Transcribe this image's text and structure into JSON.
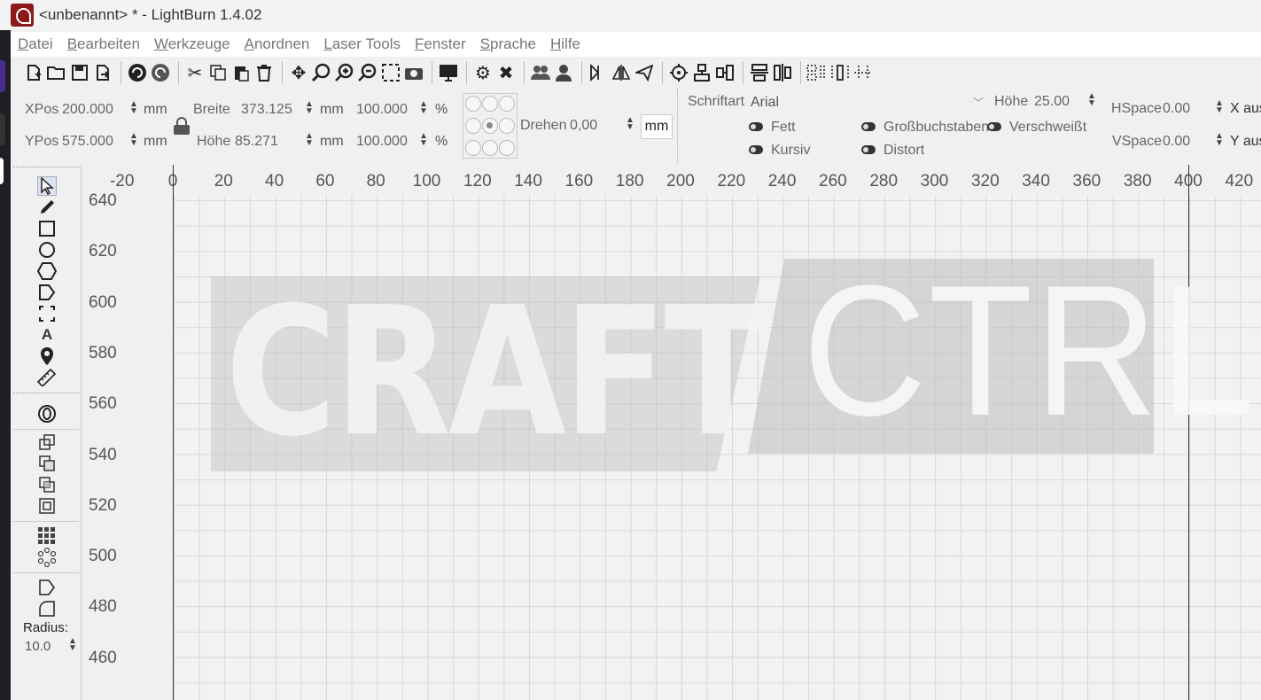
{
  "window": {
    "title": "<unbenannt> * - LightBurn 1.4.02"
  },
  "menu": [
    "Datei",
    "Bearbeiten",
    "Werkzeuge",
    "Anordnen",
    "Laser Tools",
    "Fenster",
    "Sprache",
    "Hilfe"
  ],
  "position": {
    "xpos_label": "XPos",
    "xpos_value": "200.000",
    "ypos_label": "YPos",
    "ypos_value": "575.000",
    "unit": "mm"
  },
  "size": {
    "width_label": "Breite",
    "width_value": "373.125",
    "height_label": "Höhe",
    "height_value": "85.271",
    "scale_x": "100.000",
    "scale_y": "100.000",
    "percent": "%",
    "unit": "mm"
  },
  "rotate": {
    "label": "Drehen",
    "value": "0,00",
    "unit_button": "mm"
  },
  "font": {
    "label": "Schriftart",
    "family": "Arial",
    "height_label": "Höhe",
    "height_value": "25.00",
    "hspace_label": "HSpace",
    "hspace_value": "0.00",
    "vspace_label": "VSpace",
    "vspace_value": "0.00",
    "xalign": "X aus",
    "yalign": "Y aus",
    "bold": "Fett",
    "italic": "Kursiv",
    "caps": "Großbuchstaben",
    "distort": "Distort",
    "welded": "Verschweißt"
  },
  "tools": {
    "radius_label": "Radius:",
    "radius_value": "10.0"
  },
  "ruler": {
    "x_ticks": [
      "-20",
      "0",
      "20",
      "40",
      "60",
      "80",
      "100",
      "120",
      "140",
      "160",
      "180",
      "200",
      "220",
      "240",
      "260",
      "280",
      "300",
      "320",
      "340",
      "360",
      "380",
      "400",
      "420"
    ],
    "y_ticks": [
      "640",
      "620",
      "600",
      "580",
      "560",
      "540",
      "520",
      "500",
      "480",
      "460"
    ]
  },
  "artwork": {
    "left_text": "CRAFT",
    "right_text": "CTRL"
  },
  "colors": {
    "app_logo": "#8b1a1a",
    "grid_line": "#d8d8d8",
    "bed_border": "#333333"
  }
}
